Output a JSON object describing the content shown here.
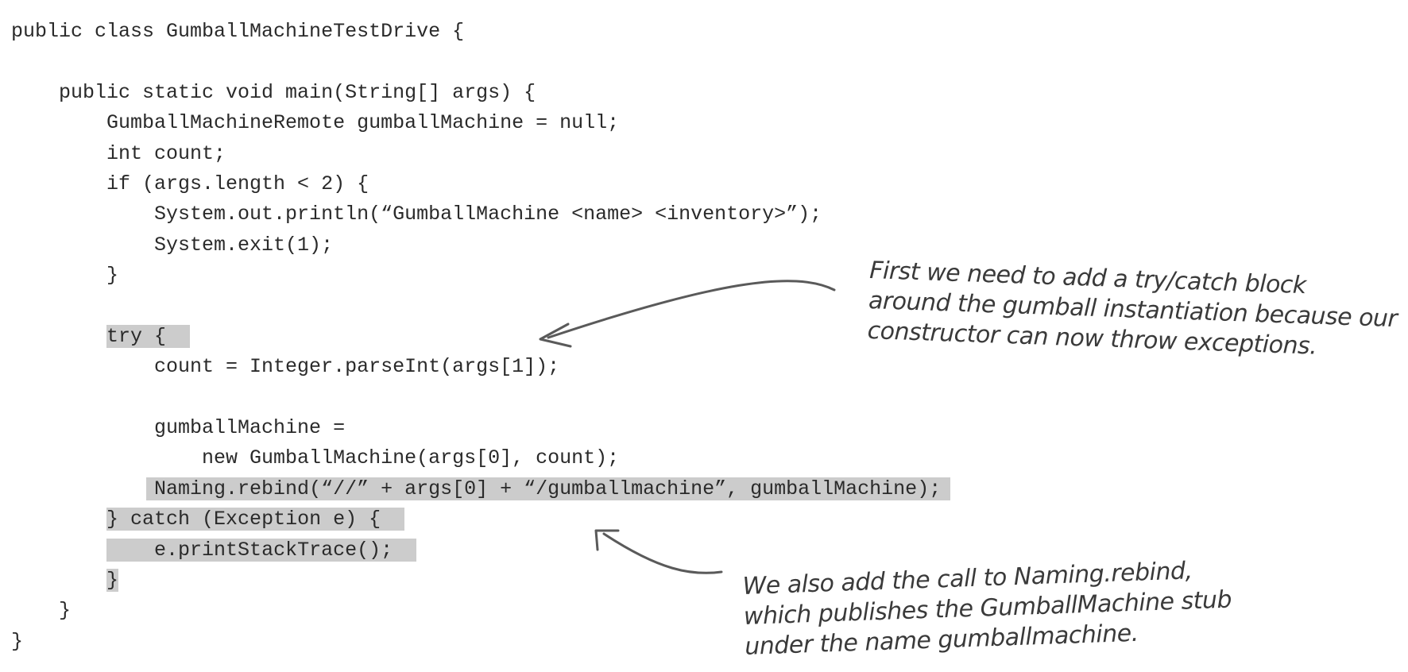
{
  "code": {
    "line1": "public class GumballMachineTestDrive {",
    "line2": "",
    "line3": "    public static void main(String[] args) {",
    "line4": "        GumballMachineRemote gumballMachine = null;",
    "line5": "        int count;",
    "line6": "        if (args.length < 2) {",
    "line7": "            System.out.println(“GumballMachine <name> <inventory>”);",
    "line8": "            System.exit(1);",
    "line9": "        }",
    "line10": "",
    "line11_indent": "        ",
    "line11_try": "try {",
    "line12": "            count = Integer.parseInt(args[1]);",
    "line13": "",
    "line14": "            gumballMachine =",
    "line15": "                new GumballMachine(args[0], count);",
    "line16_indent": "            ",
    "line16_rebind": "Naming.rebind(“//” + args[0] + “/gumballmachine”, gumballMachine);",
    "line17_indent": "        ",
    "line17_catch": "} catch (Exception e) {",
    "line18_indent": "        ",
    "line18_body": "    e.printStackTrace();",
    "line19_indent": "        ",
    "line19_close": "}",
    "line20": "    }",
    "line21": "}"
  },
  "annotations": {
    "first": {
      "line1": "First we need to add a try/catch block",
      "line2": "around the gumball instantiation because our",
      "line3": "constructor can now throw exceptions."
    },
    "second": {
      "line1": "We also add the call to Naming.rebind,",
      "line2": "which publishes the GumballMachine stub",
      "line3": "under the name gumballmachine."
    }
  },
  "colors": {
    "highlight": "#cccccc",
    "text": "#2a2a2a",
    "arrow": "#5a5a5a"
  }
}
